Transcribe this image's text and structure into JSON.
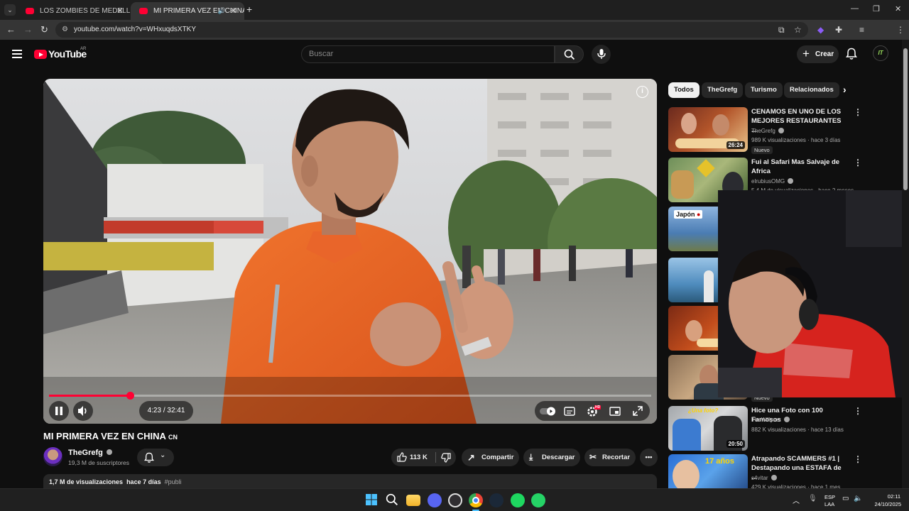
{
  "browser": {
    "tabs": [
      {
        "title": "LOS ZOMBIES DE MEDELLÍN | E"
      },
      {
        "title": "MI PRIMERA VEZ EN CHINA"
      }
    ],
    "url": "youtube.com/watch?v=WHxuqdsXTKY"
  },
  "youtube": {
    "logo_text": "YouTube",
    "country": "AR",
    "search_placeholder": "Buscar",
    "create_label": "Crear",
    "user_initials": "IT"
  },
  "player": {
    "current_time": "4:23",
    "duration": "32:41",
    "time_display": "4:23 / 32:41",
    "progress_fraction": 0.134,
    "settings_badge": "HD"
  },
  "video": {
    "title": "MI PRIMERA VEZ EN CHINA",
    "flag": "CN",
    "channel": "TheGrefg",
    "subscribers": "19,3 M de suscriptores",
    "likes": "113 K",
    "share": "Compartir",
    "download": "Descargar",
    "clip": "Recortar",
    "views": "1,7 M de visualizaciones",
    "date": "hace 7 días",
    "hashtag": "#publi"
  },
  "chips": [
    "Todos",
    "TheGrefg",
    "Turismo",
    "Relacionados"
  ],
  "recommendations": [
    {
      "title": "CENAMOS EN UNO DE LOS MEJORES RESTAURANTES ...",
      "channel": "TheGrefg",
      "meta": "989 K visualizaciones · hace 3 días",
      "duration": "26:24",
      "badge": "Nuevo"
    },
    {
      "title": "Fui al Safari Mas Salvaje de Africa",
      "channel": "elrubiusOMG",
      "meta": "5,4 M de visualizaciones · hace 2 meses",
      "duration": "",
      "badge": ""
    },
    {
      "title": "",
      "channel": "",
      "meta": "",
      "duration": "",
      "badge": "",
      "thumb_text": "Japón"
    },
    {
      "title": "",
      "channel": "",
      "meta": "",
      "duration": "",
      "badge": ""
    },
    {
      "title": "",
      "channel": "",
      "meta": "",
      "duration": "",
      "badge": ""
    },
    {
      "title": "",
      "channel": "",
      "meta": "",
      "duration": "",
      "badge": "Nuevo"
    },
    {
      "title": "Hice una Foto con 100 Famosos",
      "channel": "TheWillyrex",
      "meta": "882 K visualizaciones · hace 13 días",
      "duration": "20:50",
      "badge": "",
      "thumb_text": "¿Una foto?"
    },
    {
      "title": "Atrapando SCAMMERS #1 | Destapando una ESTAFA de ...",
      "channel": "s4vitar",
      "meta": "429 K visualizaciones · hace 1 mes",
      "duration": "",
      "badge": "",
      "thumb_text": "17 años"
    }
  ],
  "taskbar": {
    "lang_1": "ESP",
    "lang_2": "LAA",
    "time": "02:11",
    "date": "24/10/2025"
  },
  "colors": {
    "accent": "#ff0033",
    "background": "#0f0f0f",
    "surface": "#272727"
  }
}
